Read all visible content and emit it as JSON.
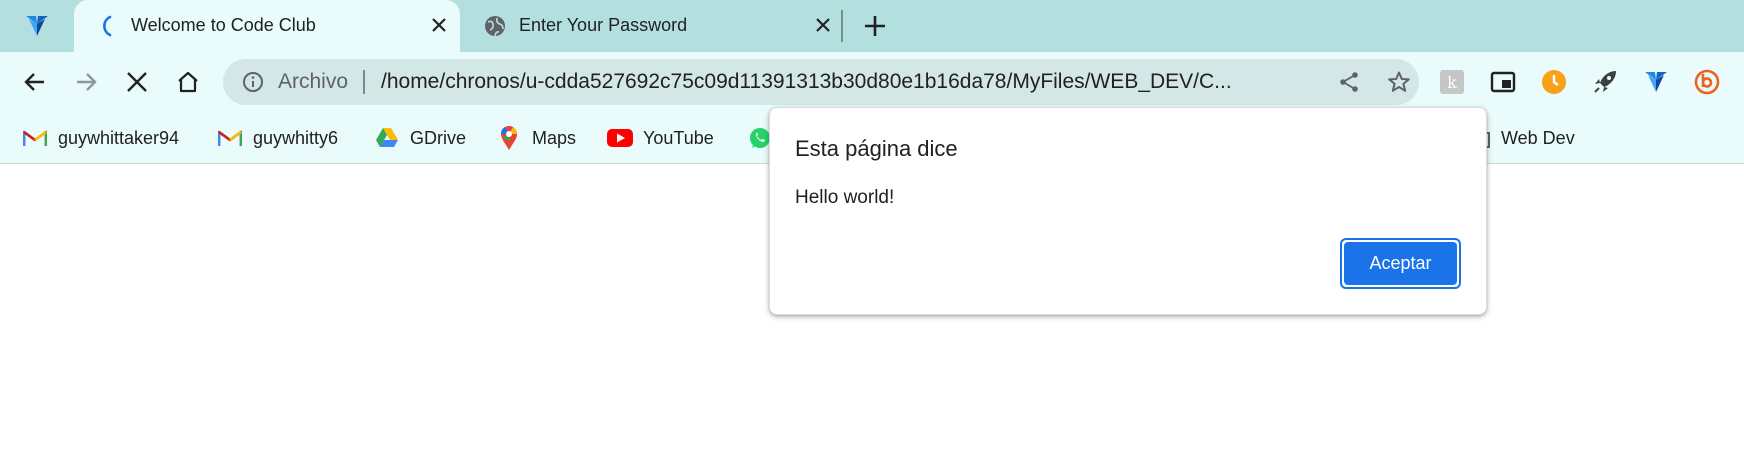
{
  "tabs": [
    {
      "title": "Welcome to Code Club",
      "state": "loading",
      "active": true
    },
    {
      "title": "Enter Your Password",
      "state": "loaded",
      "active": false
    }
  ],
  "pinned_tab": {
    "icon": "funnel-logo-icon"
  },
  "address_bar": {
    "scheme_label": "Archivo",
    "url": "/home/chronos/u-cdda527692c75c09d11391313b30d80e1b16da78/MyFiles/WEB_DEV/C..."
  },
  "extensions": [
    "keep-k-icon",
    "picture-in-picture-icon",
    "clock-extension-icon",
    "rocket-icon",
    "funnel-extension-icon",
    "bitly-icon"
  ],
  "bookmarks": [
    {
      "label": "guywhittaker94",
      "icon": "gmail-icon"
    },
    {
      "label": "guywhitty6",
      "icon": "gmail-icon"
    },
    {
      "label": "GDrive",
      "icon": "google-drive-icon"
    },
    {
      "label": "Maps",
      "icon": "google-maps-icon"
    },
    {
      "label": "YouTube",
      "icon": "youtube-icon"
    },
    {
      "label": "",
      "icon": "whatsapp-icon"
    },
    {
      "label": "Web Dev",
      "icon": "folder-icon"
    }
  ],
  "dialog": {
    "title": "Esta página dice",
    "message": "Hello world!",
    "ok_label": "Aceptar"
  },
  "colors": {
    "tabstrip": "#b3e0df",
    "toolbar": "#e9fbfa",
    "omnibox": "#d2e7e6",
    "accent": "#1a73e8"
  }
}
